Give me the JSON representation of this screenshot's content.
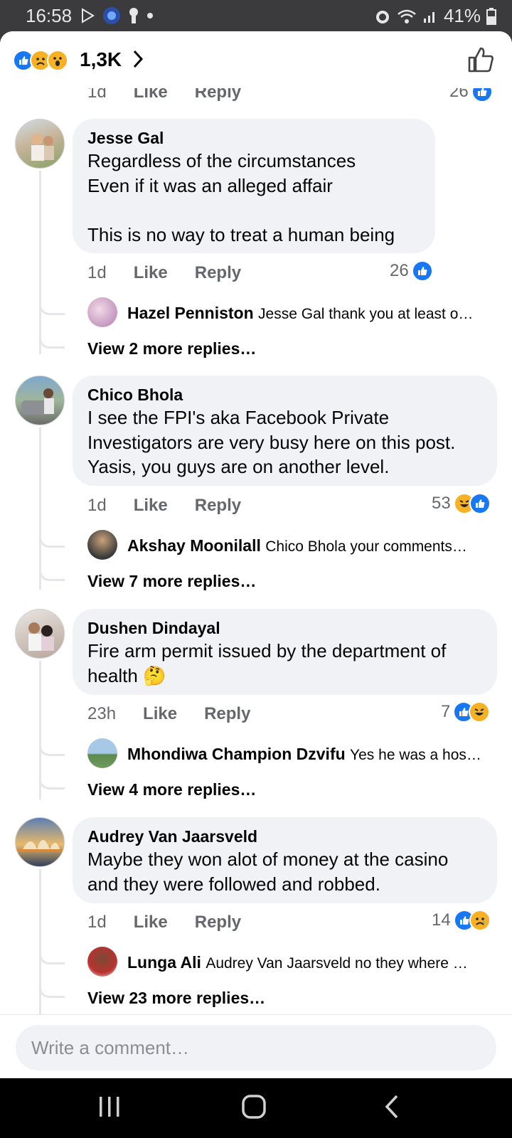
{
  "status": {
    "time": "16:58",
    "battery": "41%"
  },
  "header": {
    "reaction_count": "1,3K"
  },
  "partial_row": {
    "age": "1d",
    "like": "Like",
    "reply": "Reply",
    "count": "26"
  },
  "comments": [
    {
      "name": "Jesse Gal",
      "text": "Regardless of the circumstances\nEven if it was an alleged affair\n\nThis is no way to treat a human being",
      "age": "1d",
      "like": "Like",
      "reply": "Reply",
      "reactions": "26",
      "reply_preview": {
        "name": "Hazel Penniston",
        "text": "Jesse Gal thank you at least o…"
      },
      "more": "View 2 more replies…"
    },
    {
      "name": "Chico Bhola",
      "text": "I see the FPI's aka Facebook Private\nInvestigators are very busy here on this post.\nYasis, you guys are on another level.",
      "age": "1d",
      "like": "Like",
      "reply": "Reply",
      "reactions": "53",
      "reply_preview": {
        "name": "Akshay Moonilall",
        "text": "Chico Bhola your comments…"
      },
      "more": "View 7 more replies…"
    },
    {
      "name": "Dushen Dindayal",
      "text": "Fire arm permit issued by the department of\nhealth 🤔",
      "age": "23h",
      "like": "Like",
      "reply": "Reply",
      "reactions": "7",
      "reply_preview": {
        "name": "Mhondiwa Champion Dzvifu",
        "text": "Yes he was a hos…"
      },
      "more": "View 4 more replies…"
    },
    {
      "name": "Audrey Van Jaarsveld",
      "text": "Maybe they won alot of money at the casino\nand they were followed and robbed.",
      "age": "1d",
      "like": "Like",
      "reply": "Reply",
      "reactions": "14",
      "reply_preview": {
        "name": "Lunga Ali",
        "text": "Audrey Van Jaarsveld no they where …"
      },
      "more": "View 23 more replies…"
    }
  ],
  "composer": {
    "placeholder": "Write a comment…"
  },
  "colors": {
    "like_blue": "#1877f2",
    "bubble": "#f0f2f5",
    "haha_yellow": "#f7b125"
  }
}
